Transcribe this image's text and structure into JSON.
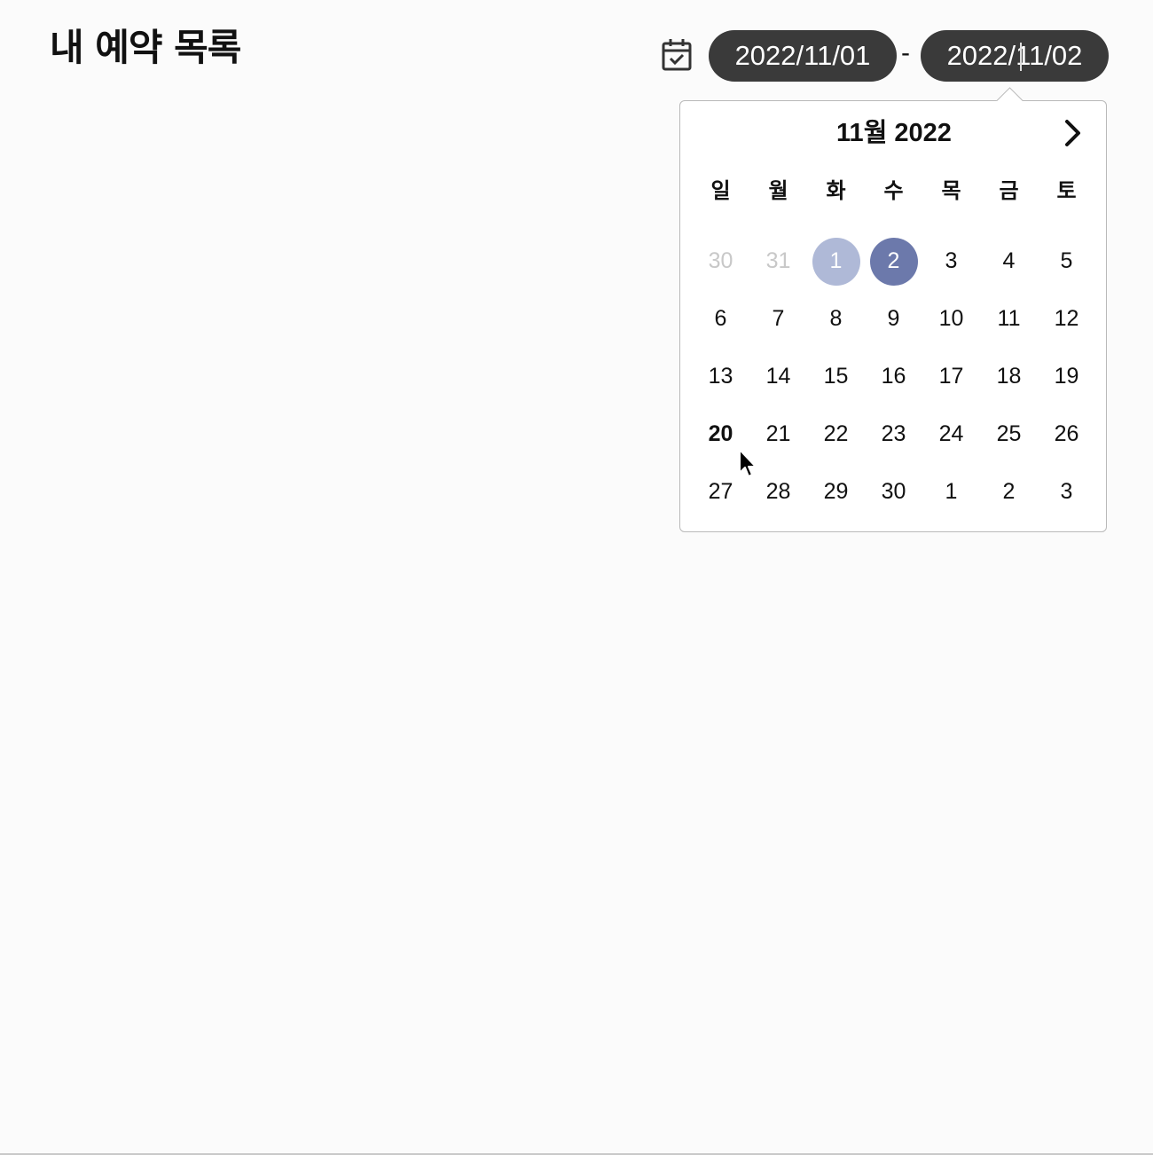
{
  "header": {
    "title": "내 예약 목록",
    "calendar_icon": "calendar-check-icon"
  },
  "date_range": {
    "start": "2022/11/01",
    "separator": "-",
    "end": "2022/11/02"
  },
  "datepicker": {
    "month_label": "11월 2022",
    "next_icon": "chevron-right-icon",
    "weekdays": [
      "일",
      "월",
      "화",
      "수",
      "목",
      "금",
      "토"
    ],
    "weeks": [
      [
        {
          "label": "30",
          "state": "outside"
        },
        {
          "label": "31",
          "state": "outside"
        },
        {
          "label": "1",
          "state": "range-start"
        },
        {
          "label": "2",
          "state": "selected"
        },
        {
          "label": "3",
          "state": ""
        },
        {
          "label": "4",
          "state": ""
        },
        {
          "label": "5",
          "state": ""
        }
      ],
      [
        {
          "label": "6",
          "state": ""
        },
        {
          "label": "7",
          "state": ""
        },
        {
          "label": "8",
          "state": ""
        },
        {
          "label": "9",
          "state": ""
        },
        {
          "label": "10",
          "state": ""
        },
        {
          "label": "11",
          "state": ""
        },
        {
          "label": "12",
          "state": ""
        }
      ],
      [
        {
          "label": "13",
          "state": ""
        },
        {
          "label": "14",
          "state": ""
        },
        {
          "label": "15",
          "state": ""
        },
        {
          "label": "16",
          "state": ""
        },
        {
          "label": "17",
          "state": ""
        },
        {
          "label": "18",
          "state": ""
        },
        {
          "label": "19",
          "state": ""
        }
      ],
      [
        {
          "label": "20",
          "state": "today"
        },
        {
          "label": "21",
          "state": ""
        },
        {
          "label": "22",
          "state": ""
        },
        {
          "label": "23",
          "state": ""
        },
        {
          "label": "24",
          "state": ""
        },
        {
          "label": "25",
          "state": ""
        },
        {
          "label": "26",
          "state": ""
        }
      ],
      [
        {
          "label": "27",
          "state": ""
        },
        {
          "label": "28",
          "state": ""
        },
        {
          "label": "29",
          "state": ""
        },
        {
          "label": "30",
          "state": ""
        },
        {
          "label": "1",
          "state": ""
        },
        {
          "label": "2",
          "state": ""
        },
        {
          "label": "3",
          "state": ""
        }
      ]
    ]
  },
  "colors": {
    "pill_bg": "#3a3a3a",
    "selected": "#6c79ab",
    "range_start": "#afb9d7",
    "outside_day": "#c8c8c8"
  }
}
